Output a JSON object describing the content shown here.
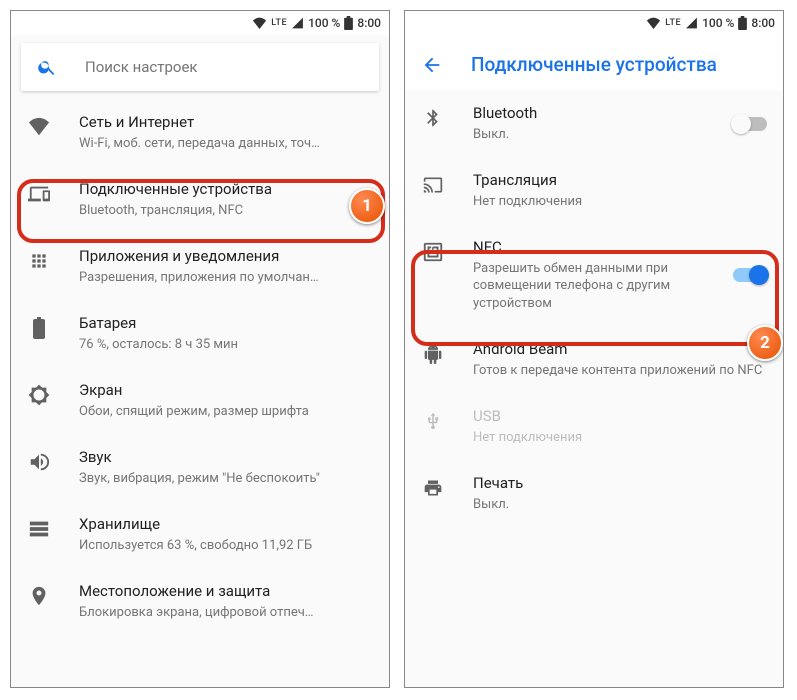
{
  "status": {
    "lte": "LTE",
    "battery": "100 %",
    "time": "8:00"
  },
  "left": {
    "search_placeholder": "Поиск настроек",
    "items": [
      {
        "title": "Сеть и Интернет",
        "subtitle": "Wi-Fi, моб. сети, передача данных, точ…"
      },
      {
        "title": "Подключенные устройства",
        "subtitle": "Bluetooth, трансляция, NFC"
      },
      {
        "title": "Приложения и уведомления",
        "subtitle": "Разрешения, приложения по умолчан…"
      },
      {
        "title": "Батарея",
        "subtitle": "76 %, осталось: 8 ч 35 мин"
      },
      {
        "title": "Экран",
        "subtitle": "Обои, спящий режим, размер шрифта"
      },
      {
        "title": "Звук",
        "subtitle": "Звук, вибрация, режим \"Не беспокоить\""
      },
      {
        "title": "Хранилище",
        "subtitle": "Используется 63 %, свободно 11,92 ГБ"
      },
      {
        "title": "Местоположение и защита",
        "subtitle": "Блокировка экрана, цифровой отпеч…"
      }
    ]
  },
  "right": {
    "header": "Подключенные устройства",
    "items": [
      {
        "title": "Bluetooth",
        "subtitle": "Выкл."
      },
      {
        "title": "Трансляция",
        "subtitle": "Нет подключения"
      },
      {
        "title": "NFC",
        "subtitle": "Разрешить обмен данными при совмещении телефона с другим устройством"
      },
      {
        "title": "Android Beam",
        "subtitle": "Готов к передаче контента приложений по NFC"
      },
      {
        "title": "USB",
        "subtitle": "Нет подключения"
      },
      {
        "title": "Печать",
        "subtitle": "Выкл."
      }
    ]
  },
  "badges": {
    "one": "1",
    "two": "2"
  }
}
